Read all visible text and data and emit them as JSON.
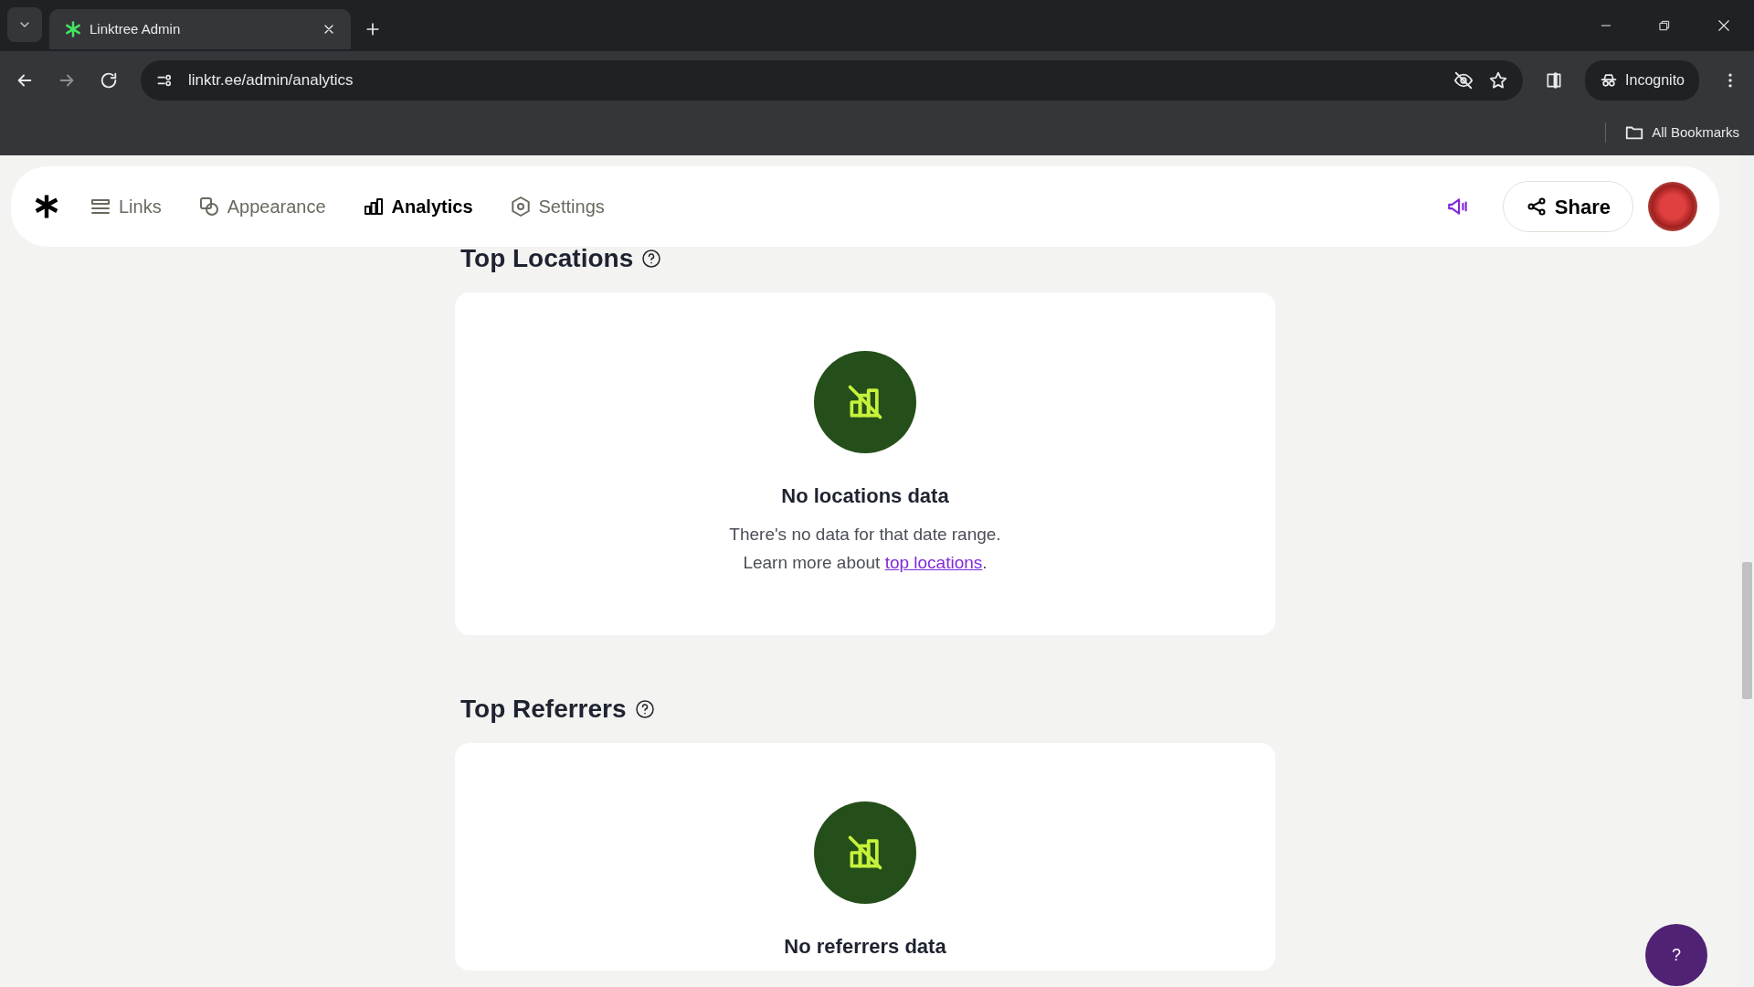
{
  "browser": {
    "tabs": [
      {
        "title": "Linktree Admin",
        "selected": true
      }
    ],
    "address": "linktr.ee/admin/analytics",
    "profile": "Incognito",
    "bookmarks": "All Bookmarks"
  },
  "nav": {
    "items": [
      {
        "label": "Links",
        "selected": false
      },
      {
        "label": "Appearance",
        "selected": false
      },
      {
        "label": "Analytics",
        "selected": true
      },
      {
        "label": "Settings",
        "selected": false
      }
    ],
    "share": "Share"
  },
  "sections": [
    {
      "title": "Top Locations",
      "empty_title": "No locations data",
      "lines": [
        "There's no data for that date range."
      ],
      "learn_prefix": "Learn more about ",
      "link": "top locations",
      "link_suffix": "."
    },
    {
      "title": "Top Referrers",
      "empty_title": "No referrers data"
    }
  ],
  "help_button": "?"
}
